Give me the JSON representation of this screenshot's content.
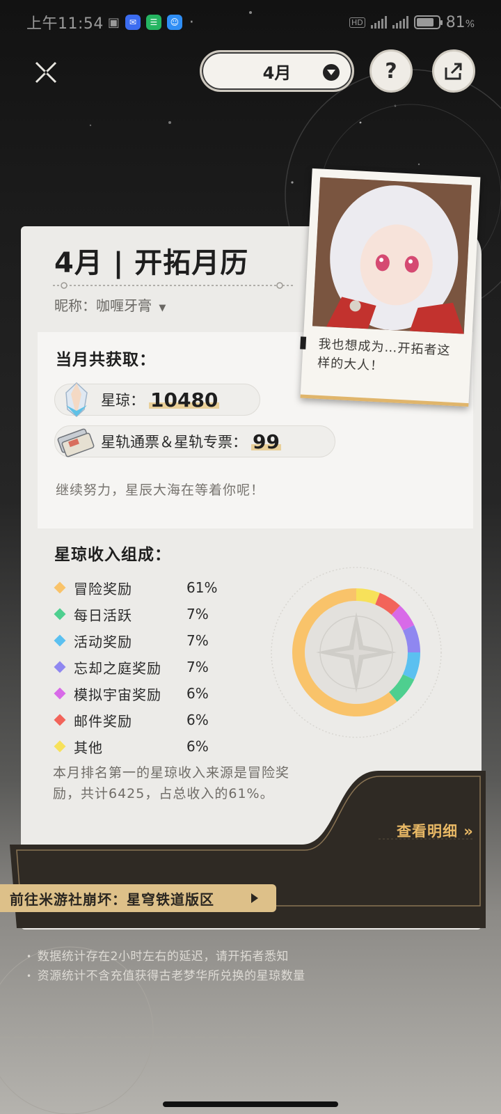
{
  "status_bar": {
    "time": "上午11:54",
    "battery": "81",
    "network_labels": [
      "5G",
      "4G"
    ],
    "hd_label": "HD",
    "app_icons": [
      "message-app-icon",
      "chat-app-icon",
      "qq-app-icon"
    ]
  },
  "top_nav": {
    "month_selector": "4月",
    "help_label": "?"
  },
  "card": {
    "title": "4月 | 开拓月历",
    "nickname": "昵称：咖喱牙膏"
  },
  "earnings": {
    "heading": "当月共获取：",
    "stellar_jade_label": "星琼：",
    "stellar_jade_value": "10480",
    "pass_label": "星轨通票＆星轨专票：",
    "pass_value": "99",
    "encouragement": "继续努力，星辰大海在等着你呢！"
  },
  "composition": {
    "heading": "星琼收入组成：",
    "items": [
      {
        "name": "冒险奖励",
        "pct": "61%",
        "color": "#f9c36a"
      },
      {
        "name": "每日活跃",
        "pct": "7%",
        "color": "#4ecf8f"
      },
      {
        "name": "活动奖励",
        "pct": "7%",
        "color": "#5bc0f0"
      },
      {
        "name": "忘却之庭奖励",
        "pct": "7%",
        "color": "#8f87f0"
      },
      {
        "name": "模拟宇宙奖励",
        "pct": "6%",
        "color": "#d86ae8"
      },
      {
        "name": "邮件奖励",
        "pct": "6%",
        "color": "#f2645a"
      },
      {
        "name": "其他",
        "pct": "6%",
        "color": "#f7e15a"
      }
    ],
    "summary": "本月排名第一的星琼收入来源是冒险奖励，共计6425，占总收入的61%。",
    "detail_link": "查看明细 »"
  },
  "chart_data": {
    "type": "pie",
    "title": "",
    "categories": [
      "冒险奖励",
      "每日活跃",
      "活动奖励",
      "忘却之庭奖励",
      "模拟宇宙奖励",
      "邮件奖励",
      "其他"
    ],
    "values": [
      61,
      7,
      7,
      7,
      6,
      6,
      6
    ],
    "colors": [
      "#f9c36a",
      "#4ecf8f",
      "#5bc0f0",
      "#8f87f0",
      "#d86ae8",
      "#f2645a",
      "#f7e15a"
    ],
    "donut": true
  },
  "polaroid": {
    "caption": "我也想成为…开拓者这样的大人！"
  },
  "community_link": "前往米游社崩坏：星穹铁道版区",
  "notes": [
    "数据统计存在2小时左右的延迟，请开拓者悉知",
    "资源统计不含充值获得古老梦华所兑换的星琼数量"
  ]
}
